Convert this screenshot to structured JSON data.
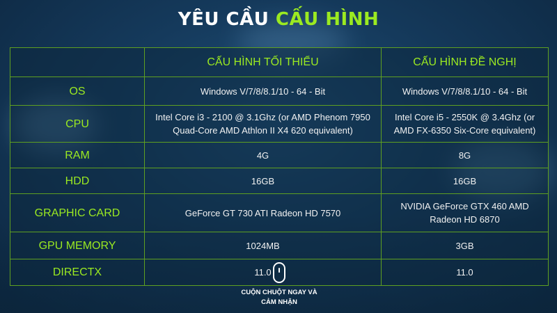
{
  "title": {
    "part1": "YÊU CẦU",
    "part2": "CẤU HÌNH"
  },
  "columns": [
    "",
    "CẤU HÌNH TỐI THIỂU",
    "CẤU HÌNH ĐỀ NGHỊ"
  ],
  "rows": [
    {
      "label": "OS",
      "min": "Windows V/7/8/8.1/10 - 64 - Bit",
      "rec": "Windows V/7/8/8.1/10 - 64 - Bit"
    },
    {
      "label": "CPU",
      "min": "Intel Core i3 - 2100 @ 3.1Ghz (or AMD Phenom 7950 Quad-Core AMD Athlon II X4 620 equivalent)",
      "rec": "Intel Core i5 - 2550K @ 3.4Ghz (or AMD FX-6350 Six-Core equivalent)"
    },
    {
      "label": "RAM",
      "min": "4G",
      "rec": "8G"
    },
    {
      "label": "HDD",
      "min": "16GB",
      "rec": "16GB"
    },
    {
      "label": "GRAPHIC CARD",
      "min": "GeForce GT 730 ATI Radeon HD 7570",
      "rec": "NVIDIA GeForce GTX 460 AMD Radeon HD 6870"
    },
    {
      "label": "GPU MEMORY",
      "min": "1024MB",
      "rec": "3GB"
    },
    {
      "label": "DIRECTX",
      "min": "11.0",
      "rec": "11.0"
    }
  ],
  "scroll_hint": {
    "line1": "CUỘN CHUỘT NGAY VÀ",
    "line2": "CẢM NHẬN"
  },
  "colors": {
    "accent": "#9bea21",
    "border": "#5fa021",
    "background": "#153a5c"
  }
}
